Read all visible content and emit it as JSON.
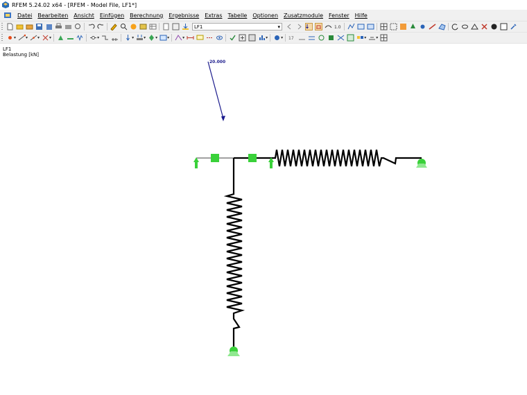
{
  "window": {
    "title": "RFEM 5.24.02 x64 - [RFEM - Model File, LF1*]"
  },
  "menu": [
    "Datei",
    "Bearbeiten",
    "Ansicht",
    "Einfügen",
    "Berechnung",
    "Ergebnisse",
    "Extras",
    "Tabelle",
    "Optionen",
    "Zusatzmodule",
    "Fenster",
    "Hilfe"
  ],
  "toolbar": {
    "loadcase_combo": "LF1"
  },
  "view": {
    "loadcase_label": "LF1",
    "load_label": "Belastung [kN]",
    "load_value": "20.000",
    "colors": {
      "support": "#44ee44",
      "load_arrow": "#1a1a8c",
      "member": "#000000"
    }
  },
  "icons": [
    "new-icon",
    "open-icon",
    "save-icon",
    "print-icon",
    "undo-icon",
    "redo-icon",
    "render-icon",
    "zoom-icon",
    "support-icon",
    "hinge-icon",
    "table-icon"
  ]
}
